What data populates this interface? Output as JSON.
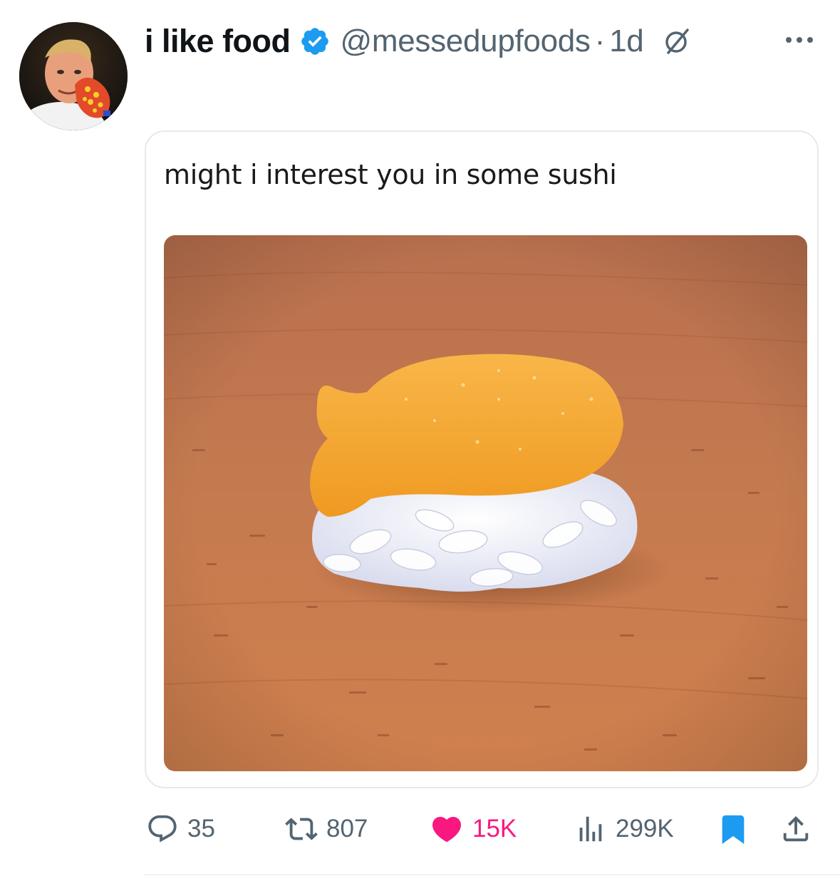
{
  "tweet": {
    "display_name": "i like food",
    "handle": "@messedupfoods",
    "separator": "·",
    "time": "1d",
    "verified": true,
    "caption": "might i interest you in some sushi",
    "image_description_icon": "goldfish-cracker-on-rice-photo"
  },
  "actions": {
    "replies": "35",
    "reposts": "807",
    "likes": "15K",
    "views": "299K",
    "liked": true,
    "bookmarked": true
  },
  "colors": {
    "accent_blue": "#1d9bf0",
    "like_pink": "#f91880",
    "secondary_text": "#536471"
  },
  "icons": [
    "avatar",
    "verified-badge-icon",
    "grok-icon",
    "more-icon",
    "reply-icon",
    "repost-icon",
    "heart-icon",
    "views-icon",
    "bookmark-icon",
    "share-icon"
  ]
}
